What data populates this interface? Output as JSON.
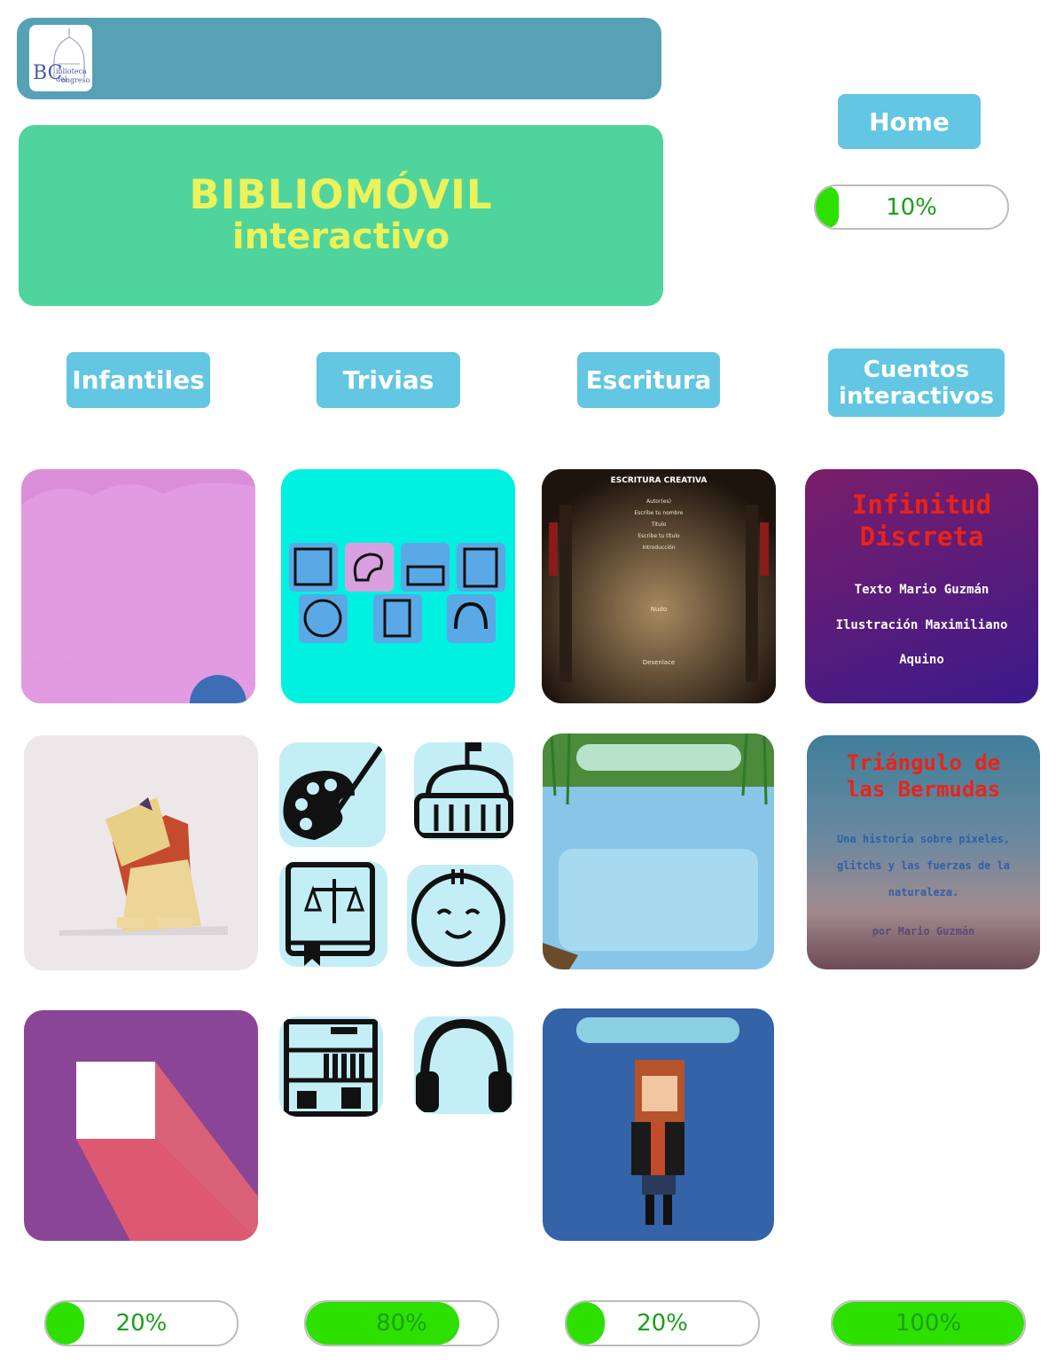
{
  "header": {
    "logo": {
      "initials": "BC",
      "text_line1": "iblioteca del",
      "text_line2": "ongreso"
    },
    "title": "BIBLIOMÓVIL",
    "subtitle": "interactivo"
  },
  "nav": {
    "home_label": "Home"
  },
  "overall_progress": {
    "value": 0.1,
    "label": "10%"
  },
  "categories": [
    {
      "label": "Infantiles",
      "progress": 0.2,
      "progress_label": "20%"
    },
    {
      "label": "Trivias",
      "progress": 0.8,
      "progress_label": "80%"
    },
    {
      "label": "Escritura",
      "progress": 0.2,
      "progress_label": "20%"
    },
    {
      "label": "Cuentos interactivos",
      "progress": 1.0,
      "progress_label": "100%"
    }
  ],
  "escritura_card": {
    "title": "ESCRITURA CREATIVA",
    "lines": [
      "Autor(es)",
      "Escribe tu nombre",
      "Título",
      "Escribe tu título",
      "Introducción"
    ],
    "section2": "Nudo",
    "section3": "Desenlace"
  },
  "stories": [
    {
      "title_line1": "Infinitud",
      "title_line2": "Discreta",
      "text": "Texto Mario Guzmán",
      "illustration": "Ilustración Maximiliano",
      "illustration2": "Aquino"
    },
    {
      "title_line1": "Triángulo de",
      "title_line2": "las Bermudas",
      "desc_line1": "Una historia sobre píxeles,",
      "desc_line2": "glitchs y las fuerzas de la",
      "desc_line3": "naturaleza.",
      "author": "por Mario Guzmán"
    }
  ],
  "trivia_icons": [
    "bookshelf-icon",
    "palette-icon",
    "congress-icon",
    "law-book-icon",
    "baby-face-icon",
    "document-icon",
    "headphones-icon"
  ],
  "colors": {
    "topbar": "#56a1b6",
    "hero": "#4ed49c",
    "hero_text": "#ecf25a",
    "button": "#63c6e2",
    "progress_fill": "#2ee000"
  }
}
